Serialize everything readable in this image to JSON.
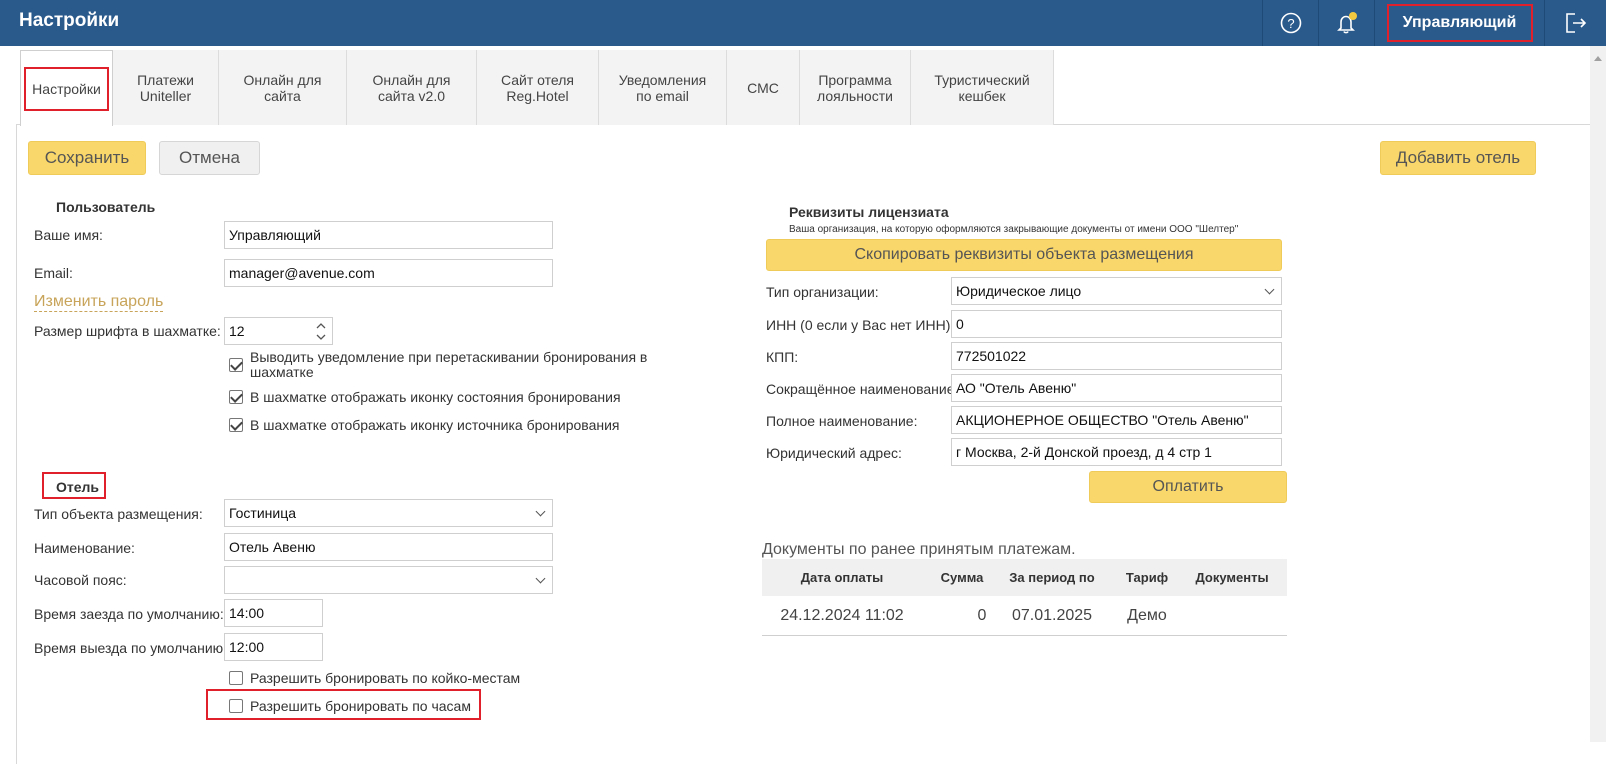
{
  "header": {
    "title": "Настройки",
    "user": "Управляющий"
  },
  "tabs": [
    {
      "label": "Настройки"
    },
    {
      "label": "Платежи\nUniteller"
    },
    {
      "label": "Онлайн для\nсайта"
    },
    {
      "label": "Онлайн для\nсайта v2.0"
    },
    {
      "label": "Сайт отеля\nReg.Hotel"
    },
    {
      "label": "Уведомления\nпо email"
    },
    {
      "label": "СМС"
    },
    {
      "label": "Программа\nлояльности"
    },
    {
      "label": "Туристический\nкешбек"
    }
  ],
  "toolbar": {
    "save": "Сохранить",
    "cancel": "Отмена",
    "add_hotel": "Добавить отель"
  },
  "user_section": {
    "title": "Пользователь",
    "name_label": "Ваше имя:",
    "name_value": "Управляющий",
    "email_label": "Email:",
    "email_value": "manager@avenue.com",
    "change_password": "Изменить пароль",
    "font_size_label": "Размер шрифта в шахматке:",
    "font_size_value": "12",
    "checkboxes": [
      {
        "label": "Выводить уведомление при перетаскивании бронирования в шахматке",
        "checked": true
      },
      {
        "label": "В шахматке отображать иконку состояния бронирования",
        "checked": true
      },
      {
        "label": "В шахматке отображать иконку источника бронирования",
        "checked": true
      }
    ]
  },
  "hotel_section": {
    "title": "Отель",
    "type_label": "Тип объекта размещения:",
    "type_value": "Гостиница",
    "name_label": "Наименование:",
    "name_value": "Отель Авеню",
    "tz_label": "Часовой пояс:",
    "tz_value": "",
    "checkin_label": "Время заезда по умолчанию:",
    "checkin_value": "14:00",
    "checkout_label": "Время выезда по умолчанию:",
    "checkout_value": "12:00",
    "checkboxes": [
      {
        "label": "Разрешить бронировать по койко-местам",
        "checked": false
      },
      {
        "label": "Разрешить бронировать по часам",
        "checked": false
      }
    ]
  },
  "licensee": {
    "title": "Реквизиты лицензиата",
    "note": "Ваша организация, на которую оформляются закрывающие документы от имени ООО \"Шелтер\"",
    "copy_button": "Скопировать реквизиты объекта размещения",
    "org_type_label": "Тип организации:",
    "org_type_value": "Юридическое лицо",
    "inn_label": "ИНН (0 если у Вас нет ИНН):",
    "inn_value": "0",
    "kpp_label": "КПП:",
    "kpp_value": "772501022",
    "short_name_label": "Сокращённое наименование:",
    "short_name_value": "АО \"Отель Авеню\"",
    "full_name_label": "Полное наименование:",
    "full_name_value": "АКЦИОНЕРНОЕ ОБЩЕСТВО \"Отель Авеню\"",
    "address_label": "Юридический адрес:",
    "address_value": "г Москва, 2-й Донской проезд, д 4 стр 1",
    "pay_button": "Оплатить"
  },
  "documents": {
    "title": "Документы по ранее принятым платежам.",
    "columns": [
      "Дата оплаты",
      "Сумма",
      "За период по",
      "Тариф",
      "Документы"
    ],
    "rows": [
      [
        "24.12.2024 11:02",
        "0",
        "07.01.2025",
        "Демо",
        ""
      ]
    ]
  }
}
